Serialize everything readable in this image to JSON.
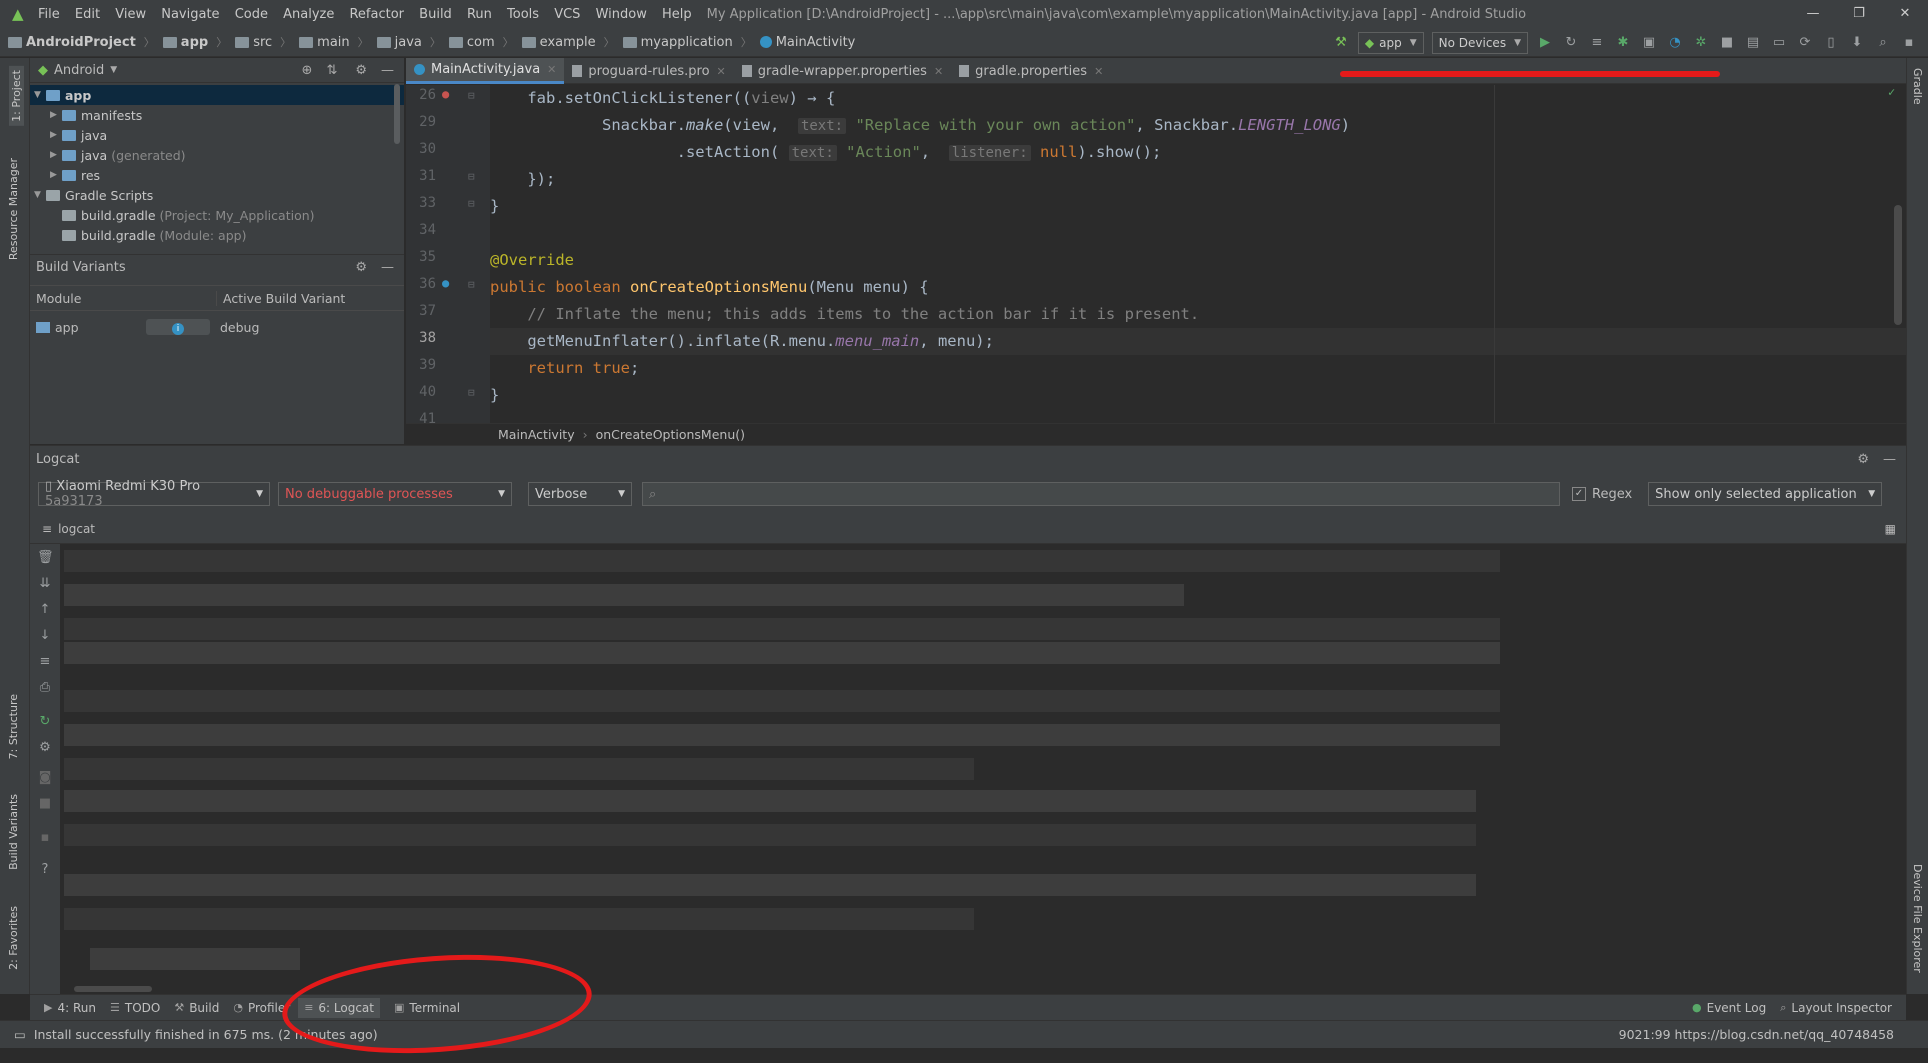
{
  "window": {
    "title": "My Application [D:\\AndroidProject] - ...\\app\\src\\main\\java\\com\\example\\myapplication\\MainActivity.java [app] - Android Studio",
    "menu": [
      "File",
      "Edit",
      "View",
      "Navigate",
      "Code",
      "Analyze",
      "Refactor",
      "Build",
      "Run",
      "Tools",
      "VCS",
      "Window",
      "Help"
    ]
  },
  "navbar": {
    "crumbs": [
      "AndroidProject",
      "app",
      "src",
      "main",
      "java",
      "com",
      "example",
      "myapplication",
      "MainActivity"
    ],
    "run_config": "app",
    "device": "No Devices"
  },
  "left_stripe": {
    "project": "1: Project",
    "resource_manager": "Resource Manager",
    "structure": "7: Structure",
    "build_variants": "Build Variants",
    "favorites": "2: Favorites"
  },
  "right_stripe": {
    "gradle": "Gradle",
    "device_file_explorer": "Device File Explorer"
  },
  "project": {
    "view": "Android",
    "tree": [
      {
        "label": "app",
        "note": "",
        "level": 0,
        "expanded": true
      },
      {
        "label": "manifests",
        "note": "",
        "level": 1,
        "expanded": false
      },
      {
        "label": "java",
        "note": "",
        "level": 1,
        "expanded": false
      },
      {
        "label": "java",
        "note": "(generated)",
        "level": 1,
        "expanded": false
      },
      {
        "label": "res",
        "note": "",
        "level": 1,
        "expanded": false
      },
      {
        "label": "Gradle Scripts",
        "note": "",
        "level": 0,
        "expanded": true
      },
      {
        "label": "build.gradle",
        "note": "(Project: My_Application)",
        "level": 1,
        "expanded": false
      },
      {
        "label": "build.gradle",
        "note": "(Module: app)",
        "level": 1,
        "expanded": false
      }
    ]
  },
  "build_variants": {
    "title": "Build Variants",
    "col_module": "Module",
    "col_variant": "Active Build Variant",
    "rows": [
      {
        "module": "app",
        "variant": "debug"
      }
    ]
  },
  "editor": {
    "tabs": [
      "MainActivity.java",
      "proguard-rules.pro",
      "gradle-wrapper.properties",
      "gradle.properties"
    ],
    "line_numbers": [
      "26",
      "29",
      "30",
      "31",
      "33",
      "34",
      "35",
      "36",
      "37",
      "38",
      "39",
      "40",
      "41"
    ],
    "breadcrumb": [
      "MainActivity",
      "onCreateOptionsMenu()"
    ]
  },
  "logcat": {
    "title": "Logcat",
    "device": "Xiaomi Redmi K30 Pro",
    "device_serial": "5a93173",
    "process": "No debuggable processes",
    "level": "Verbose",
    "search": "",
    "regex_label": "Regex",
    "filter": "Show only selected application",
    "sub_tab": "logcat"
  },
  "bottom_tabs": [
    "4: Run",
    "TODO",
    "Build",
    "Profiler",
    "6: Logcat",
    "Terminal"
  ],
  "right_bottom_tabs": [
    "Event Log",
    "Layout Inspector"
  ],
  "status": {
    "message": "Install successfully finished in 675 ms. (2 minutes ago)",
    "right": "9021:99 https://blog.csdn.net/qq_40748458"
  },
  "colors": {
    "annotation": "#e41a1a",
    "accent": "#4a88c7"
  }
}
